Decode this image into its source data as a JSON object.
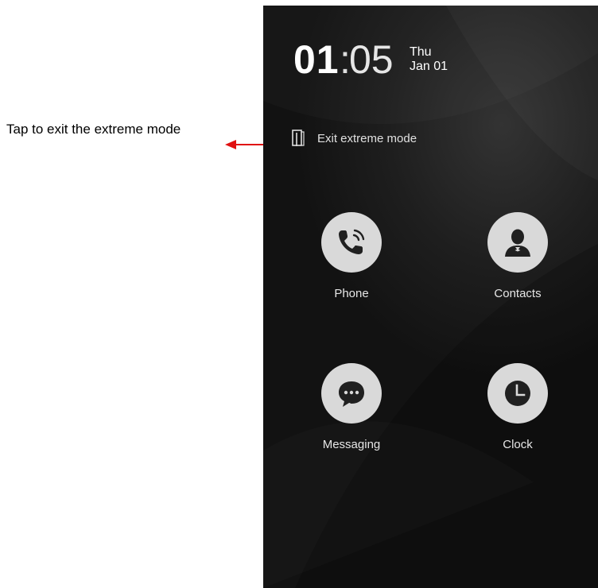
{
  "annotation": {
    "text": "Tap to exit the extreme mode",
    "arrow_color": "#e01010"
  },
  "status": {
    "hour": "01",
    "separator": ":",
    "minute": "05",
    "day": "Thu",
    "date": "Jan 01"
  },
  "exit_mode": {
    "icon": "door-exit-icon",
    "label": "Exit extreme mode"
  },
  "apps": [
    {
      "label": "Phone",
      "icon": "phone-icon"
    },
    {
      "label": "Contacts",
      "icon": "contacts-icon"
    },
    {
      "label": "Messaging",
      "icon": "messaging-icon"
    },
    {
      "label": "Clock",
      "icon": "clock-icon"
    }
  ],
  "colors": {
    "icon_circle": "#d9d9d9",
    "icon_glyph": "#202020",
    "background": "#1e1e1e"
  }
}
